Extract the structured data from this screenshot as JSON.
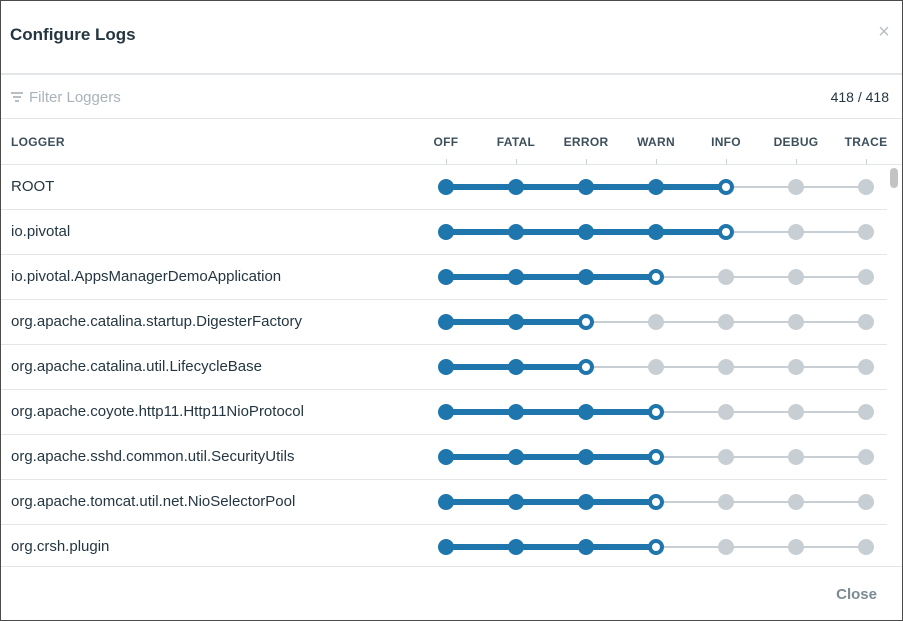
{
  "dialog": {
    "title": "Configure Logs",
    "close_icon": "×",
    "footer_close_label": "Close"
  },
  "filter": {
    "placeholder": "Filter Loggers",
    "value": "",
    "count": "418 / 418"
  },
  "columns": {
    "logger": "LOGGER",
    "levels": [
      "OFF",
      "FATAL",
      "ERROR",
      "WARN",
      "INFO",
      "DEBUG",
      "TRACE"
    ]
  },
  "loggers": [
    {
      "name": "ROOT",
      "level": "INFO"
    },
    {
      "name": "io.pivotal",
      "level": "INFO"
    },
    {
      "name": "io.pivotal.AppsManagerDemoApplication",
      "level": "WARN"
    },
    {
      "name": "org.apache.catalina.startup.DigesterFactory",
      "level": "ERROR"
    },
    {
      "name": "org.apache.catalina.util.LifecycleBase",
      "level": "ERROR"
    },
    {
      "name": "org.apache.coyote.http11.Http11NioProtocol",
      "level": "WARN"
    },
    {
      "name": "org.apache.sshd.common.util.SecurityUtils",
      "level": "WARN"
    },
    {
      "name": "org.apache.tomcat.util.net.NioSelectorPool",
      "level": "WARN"
    },
    {
      "name": "org.crsh.plugin",
      "level": "WARN"
    }
  ],
  "colors": {
    "active": "#1f76ad",
    "inactive": "#c8cfd4"
  }
}
